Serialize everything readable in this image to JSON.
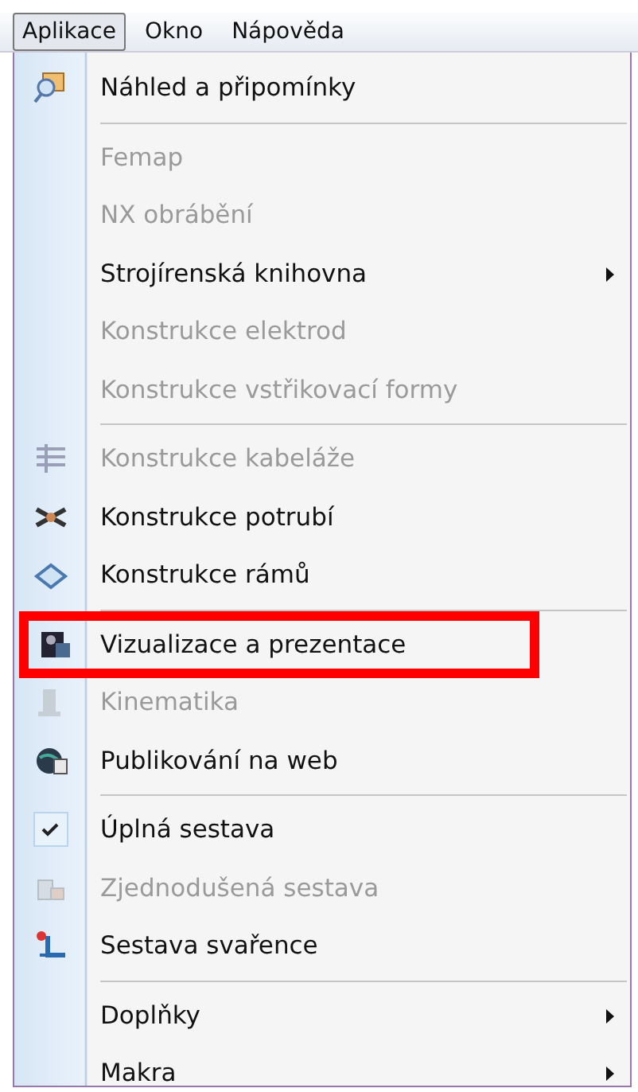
{
  "menubar": [
    {
      "label": "Aplikace",
      "selected": true
    },
    {
      "label": "Okno",
      "selected": false
    },
    {
      "label": "Nápověda",
      "selected": false
    }
  ],
  "menu": [
    {
      "kind": "item",
      "label": "Náhled a připomínky",
      "disabled": false,
      "submenu": false,
      "checked": false,
      "highlighted": false
    },
    {
      "kind": "separator"
    },
    {
      "kind": "item",
      "label": "Femap",
      "disabled": true,
      "submenu": false,
      "checked": false,
      "highlighted": false
    },
    {
      "kind": "item",
      "label": "NX obrábění",
      "disabled": true,
      "submenu": false,
      "checked": false,
      "highlighted": false
    },
    {
      "kind": "item",
      "label": "Strojírenská knihovna",
      "disabled": false,
      "submenu": true,
      "checked": false,
      "highlighted": false
    },
    {
      "kind": "item",
      "label": "Konstrukce elektrod",
      "disabled": true,
      "submenu": false,
      "checked": false,
      "highlighted": false
    },
    {
      "kind": "item",
      "label": "Konstrukce vstřikovací formy",
      "disabled": true,
      "submenu": false,
      "checked": false,
      "highlighted": false
    },
    {
      "kind": "separator"
    },
    {
      "kind": "item",
      "label": "Konstrukce kabeláže",
      "disabled": true,
      "submenu": false,
      "checked": false,
      "highlighted": false
    },
    {
      "kind": "item",
      "label": "Konstrukce potrubí",
      "disabled": false,
      "submenu": false,
      "checked": false,
      "highlighted": false
    },
    {
      "kind": "item",
      "label": "Konstrukce rámů",
      "disabled": false,
      "submenu": false,
      "checked": false,
      "highlighted": false
    },
    {
      "kind": "separator"
    },
    {
      "kind": "item",
      "label": "Vizualizace a prezentace",
      "disabled": false,
      "submenu": false,
      "checked": false,
      "highlighted": true
    },
    {
      "kind": "item",
      "label": "Kinematika",
      "disabled": true,
      "submenu": false,
      "checked": false,
      "highlighted": false
    },
    {
      "kind": "item",
      "label": "Publikování na web",
      "disabled": false,
      "submenu": false,
      "checked": false,
      "highlighted": false
    },
    {
      "kind": "separator"
    },
    {
      "kind": "item",
      "label": "Úplná sestava",
      "disabled": false,
      "submenu": false,
      "checked": true,
      "highlighted": false
    },
    {
      "kind": "item",
      "label": "Zjednodušená sestava",
      "disabled": true,
      "submenu": false,
      "checked": false,
      "highlighted": false
    },
    {
      "kind": "item",
      "label": "Sestava svařence",
      "disabled": false,
      "submenu": false,
      "checked": false,
      "highlighted": false
    },
    {
      "kind": "separator"
    },
    {
      "kind": "item",
      "label": "Doplňky",
      "disabled": false,
      "submenu": true,
      "checked": false,
      "highlighted": false
    },
    {
      "kind": "item",
      "label": "Makra",
      "disabled": false,
      "submenu": true,
      "checked": false,
      "highlighted": false
    }
  ]
}
